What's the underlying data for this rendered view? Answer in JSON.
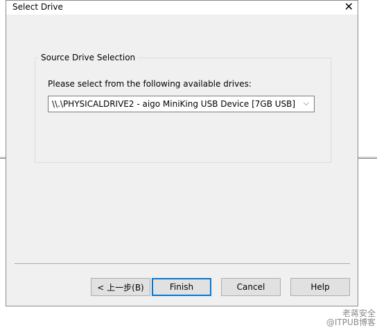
{
  "window": {
    "title": "Select Drive",
    "close_glyph": "✕"
  },
  "source_group": {
    "label": "Source Drive Selection",
    "prompt": "Please select from the following available drives:",
    "selected_drive": "\\\\.\\PHYSICALDRIVE2 - aigo MiniKing USB Device [7GB USB]",
    "dropdown_icon": "chevron-down-icon"
  },
  "buttons": {
    "back": "< 上一步(B)",
    "finish": "Finish",
    "cancel": "Cancel",
    "help": "Help"
  },
  "watermark": {
    "line1": "老蒋安全",
    "line2": "@ITPUB博客"
  }
}
